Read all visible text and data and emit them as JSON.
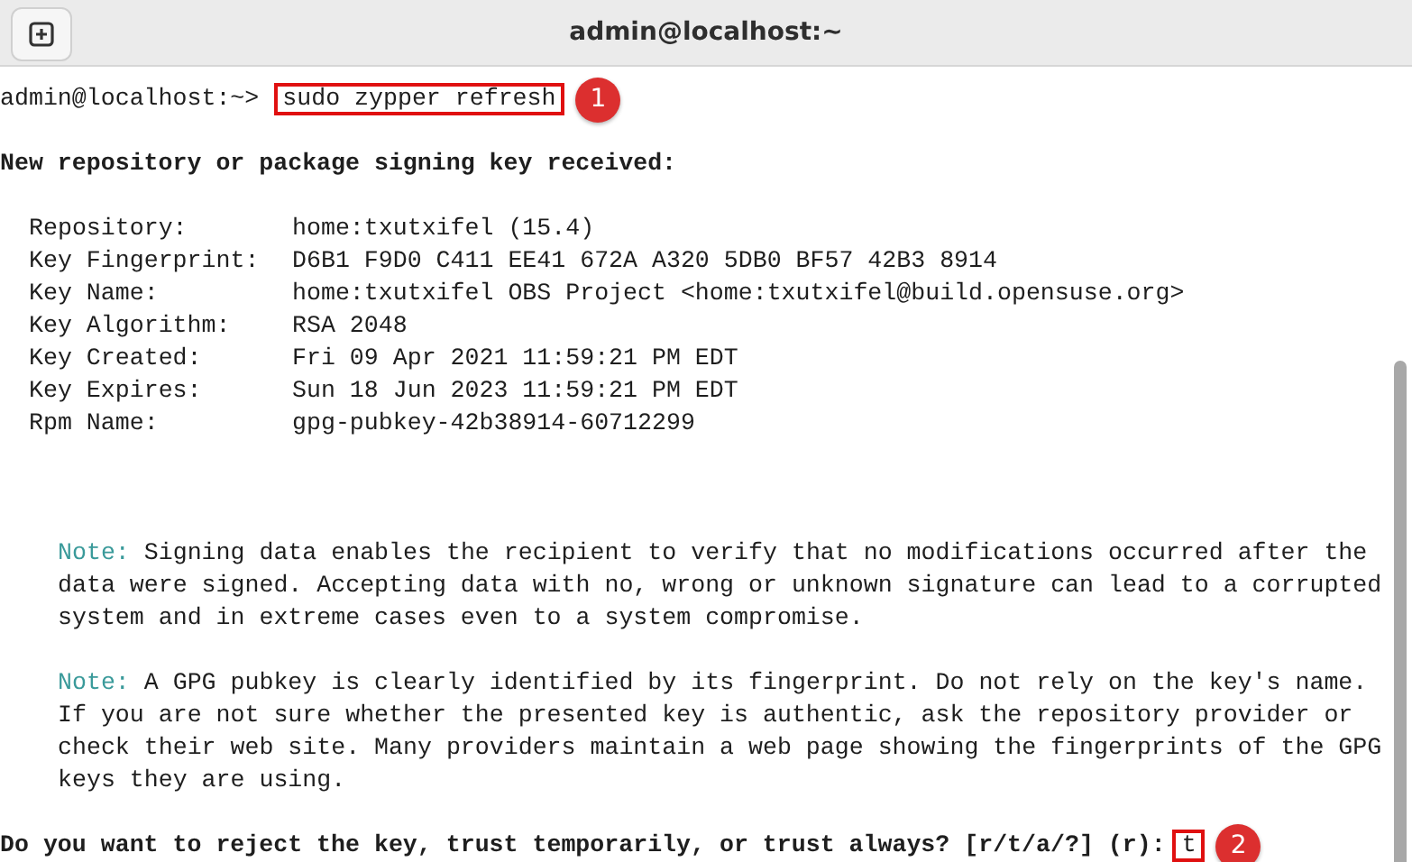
{
  "window": {
    "title": "admin@localhost:~"
  },
  "prompt_line": {
    "prompt": "admin@localhost:~>",
    "command": "sudo zypper refresh",
    "callout": "1"
  },
  "heading": "New repository or package signing key received:",
  "key_details": [
    {
      "label": "Repository:",
      "value": "home:txutxifel (15.4)"
    },
    {
      "label": "Key Fingerprint:",
      "value": "D6B1 F9D0 C411 EE41 672A A320 5DB0 BF57 42B3 8914"
    },
    {
      "label": "Key Name:",
      "value": "home:txutxifel OBS Project <home:txutxifel@build.opensuse.org>"
    },
    {
      "label": "Key Algorithm:",
      "value": "RSA 2048"
    },
    {
      "label": "Key Created:",
      "value": "Fri 09 Apr 2021 11:59:21 PM EDT"
    },
    {
      "label": "Key Expires:",
      "value": "Sun 18 Jun 2023 11:59:21 PM EDT"
    },
    {
      "label": "Rpm Name:",
      "value": "gpg-pubkey-42b38914-60712299"
    }
  ],
  "notes": [
    {
      "label": "Note:",
      "lines": [
        "Signing data enables the recipient to verify that no modifications occurred after the",
        "data were signed. Accepting data with no, wrong or unknown signature can lead to a corrupted",
        "system and in extreme cases even to a system compromise."
      ]
    },
    {
      "label": "Note:",
      "lines": [
        "A GPG pubkey is clearly identified by its fingerprint. Do not rely on the key's name.",
        "If you are not sure whether the presented key is authentic, ask the repository provider or",
        "check their web site. Many providers maintain a web page showing the fingerprints of the GPG",
        "keys they are using."
      ]
    }
  ],
  "question": {
    "text": "Do you want to reject the key, trust temporarily, or trust always? [r/t/a/?] (r):",
    "answer": "t",
    "callout": "2"
  }
}
